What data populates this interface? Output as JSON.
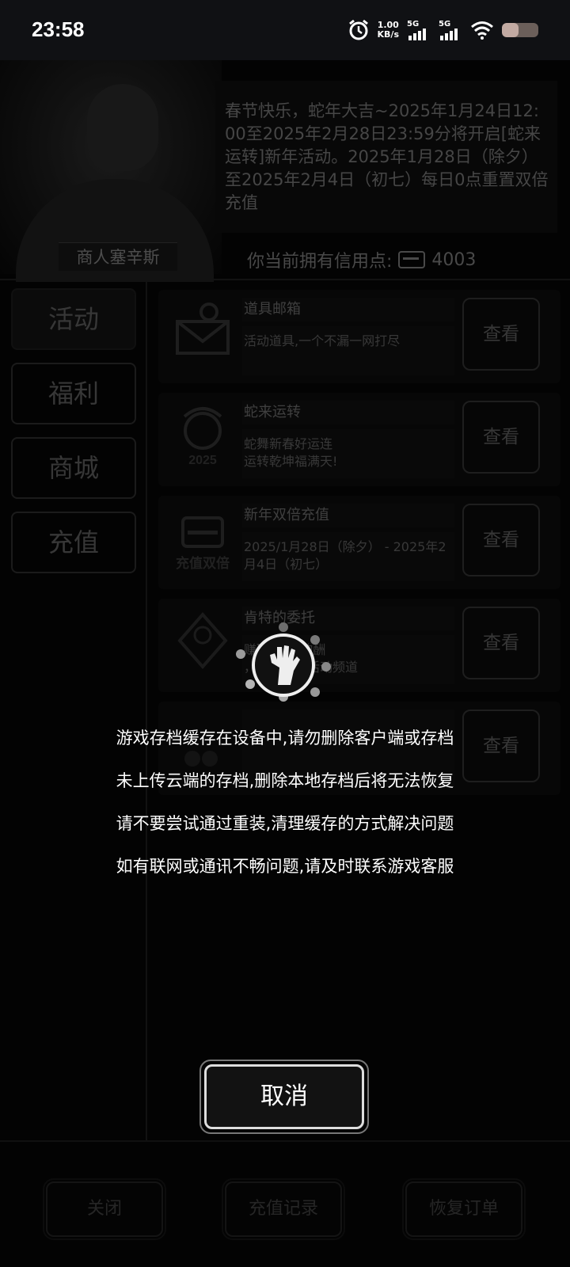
{
  "status_bar": {
    "time": "23:58",
    "net_speed_value": "1.00",
    "net_speed_unit": "KB/s",
    "signal1_label": "5G",
    "signal2_label": "5G",
    "battery_level": 0.45
  },
  "merchant": {
    "name": "商人塞辛斯"
  },
  "announcement": "春节快乐，蛇年大吉~2025年1月24日12:00至2025年2月28日23:59分将开启[蛇来运转]新年活动。2025年1月28日（除夕）至2025年2月4日（初七）每日0点重置双倍充值",
  "credits": {
    "label": "你当前拥有信用点:",
    "value": "4003"
  },
  "sidebar": {
    "items": [
      {
        "label": "活动"
      },
      {
        "label": "福利"
      },
      {
        "label": "商城"
      },
      {
        "label": "充值"
      }
    ]
  },
  "activities": [
    {
      "title": "道具邮箱",
      "desc": "活动道具,一个不漏一网打尽",
      "button": "查看",
      "icon": "mail-icon"
    },
    {
      "title": "蛇来运转",
      "desc": "蛇舞新春好运连\n运转乾坤福满天!",
      "button": "查看",
      "icon": "snake-2025-icon"
    },
    {
      "title": "新年双倍充值",
      "desc": "2025/1月28日（除夕） - 2025年2月4日（初七）",
      "button": "查看",
      "icon": "double-recharge-icon",
      "icon_text": "充值双倍"
    },
    {
      "title": "肯特的委托",
      "desc": "赚取\"肯特的酬\n，前往电台活动频道",
      "button": "查看",
      "icon": "kent-badge-icon"
    },
    {
      "title": "",
      "desc": "",
      "button": "查看",
      "icon": "group-icon"
    }
  ],
  "bottom_buttons": {
    "close": "关闭",
    "recharge_history": "充值记录",
    "restore_order": "恢复订单"
  },
  "loading": {
    "notice_lines": [
      "游戏存档缓存在设备中,请勿删除客户端或存档",
      "未上传云端的存档,删除本地存档后将无法恢复",
      "请不要尝试通过重装,清理缓存的方式解决问题",
      "如有联网或通讯不畅问题,请及时联系游戏客服"
    ],
    "cancel_label": "取消"
  }
}
